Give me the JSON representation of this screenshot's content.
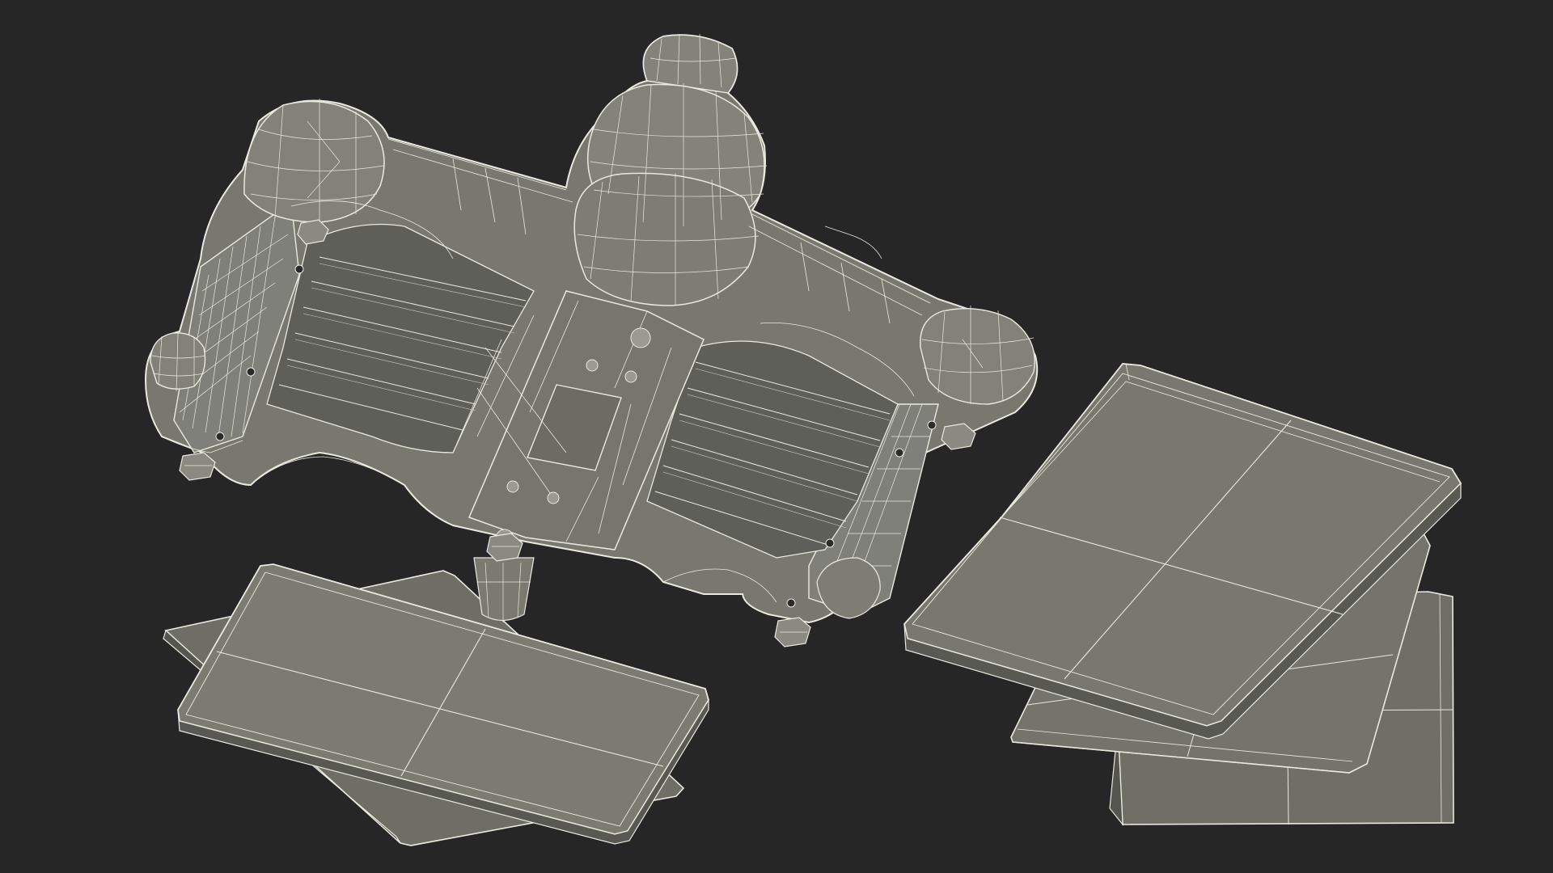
{
  "scene": {
    "background_color": "#262626",
    "surface_color": "#7b7b72",
    "surface_dark_color": "#5f5f58",
    "surface_light_color": "#8e8e84",
    "wire_color": "#e9e9df",
    "objects": [
      {
        "name": "tray-body",
        "type": "wireframe-mesh"
      },
      {
        "name": "lid-plate-left-front",
        "type": "wireframe-mesh"
      },
      {
        "name": "lid-plate-left-back",
        "type": "wireframe-mesh"
      },
      {
        "name": "lid-plate-right-front",
        "type": "wireframe-mesh"
      },
      {
        "name": "lid-plate-right-middle",
        "type": "wireframe-mesh"
      },
      {
        "name": "lid-plate-right-back",
        "type": "wireframe-mesh"
      }
    ]
  }
}
